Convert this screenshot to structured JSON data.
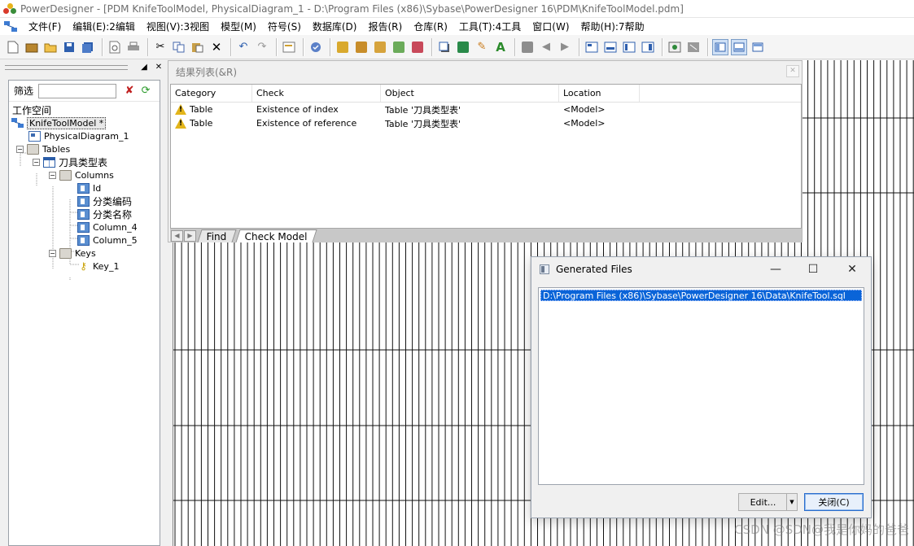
{
  "window": {
    "title": "PowerDesigner - [PDM KnifeToolModel, PhysicalDiagram_1 - D:\\Program Files (x86)\\Sybase\\PowerDesigner 16\\PDM\\KnifeToolModel.pdm]"
  },
  "menu": [
    "文件(F)",
    "编辑(E):2编辑",
    "视图(V):3视图",
    "模型(M)",
    "符号(S)",
    "数据库(D)",
    "报告(R)",
    "仓库(R)",
    "工具(T):4工具",
    "窗口(W)",
    "帮助(H):7帮助"
  ],
  "toolbar": {
    "groups": [
      [
        "new-icon",
        "model-icon",
        "open-icon",
        "save-icon",
        "save-all-icon"
      ],
      [
        "print-preview-icon",
        "print-icon"
      ],
      [
        "cut-icon",
        "copy-icon",
        "paste-icon",
        "delete-icon"
      ],
      [
        "undo-icon",
        "redo-icon"
      ],
      [
        "properties-icon"
      ],
      [
        "check-model-icon"
      ],
      [
        "generate-icon",
        "reverse-icon",
        "compare-icon",
        "merge-icon",
        "impact-icon"
      ],
      [
        "shadow-icon",
        "text-style-icon",
        "paint-icon",
        "font-icon"
      ],
      [
        "align-icon",
        "back-icon",
        "forward-icon"
      ],
      [
        "browser-icon",
        "output-icon",
        "result-icon",
        "diagram-icon"
      ],
      [
        "zoom-icon",
        "grid-icon"
      ],
      [
        "toolbox-icon",
        "output-window-icon",
        "result-list-icon"
      ]
    ]
  },
  "browser": {
    "filter_label": "筛选",
    "workspace": "工作空间",
    "nodes": {
      "model": "KnifeToolModel *",
      "diagram": "PhysicalDiagram_1",
      "tables": "Tables",
      "table": "刀具类型表",
      "columns": "Columns",
      "col1": "Id",
      "col2": "分类编码",
      "col3": "分类名称",
      "col4": "Column_4",
      "col5": "Column_5",
      "keys": "Keys",
      "key1": "Key_1"
    }
  },
  "result_list": {
    "title": "结果列表(&R)",
    "columns": [
      "Category",
      "Check",
      "Object",
      "Location"
    ],
    "rows": [
      {
        "category": "Table",
        "check": "Existence of index",
        "object": "Table '刀具类型表'",
        "location": "<Model>"
      },
      {
        "category": "Table",
        "check": "Existence of reference",
        "object": "Table '刀具类型表'",
        "location": "<Model>"
      }
    ],
    "tabs": {
      "find": "Find",
      "check_model": "Check Model"
    }
  },
  "generated_files": {
    "title": "Generated Files",
    "files": [
      "D:\\Program Files (x86)\\Sybase\\PowerDesigner 16\\Data\\KnifeTool.sql"
    ],
    "edit_label": "Edit...",
    "close_label": "关闭(C)"
  },
  "watermark": "CSDN @SDN@我是你妈的爸爸"
}
